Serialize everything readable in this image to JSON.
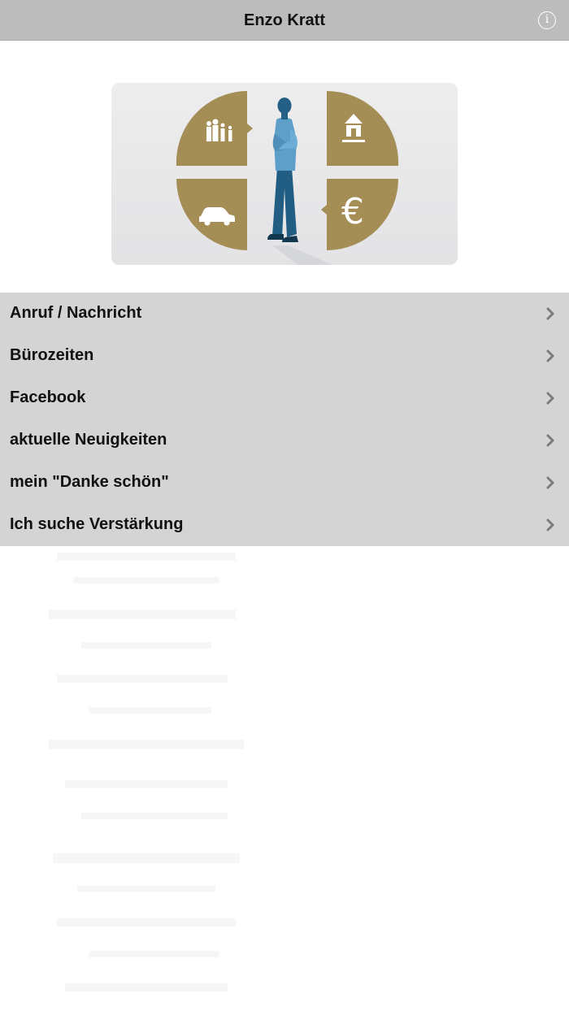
{
  "navbar": {
    "title": "Enzo Kratt",
    "info_icon": "info-icon",
    "info_glyph": "i"
  },
  "hero": {
    "image": "insurance-advisor-illustration",
    "euro_glyph": "€",
    "colors": {
      "gold": "#a48e56",
      "figure": "#2d6a91",
      "background": "#e9e9ea"
    }
  },
  "menu": {
    "chevron_icon": "chevron-right-icon",
    "items": [
      {
        "label": "Anruf / Nachricht"
      },
      {
        "label": "Bürozeiten"
      },
      {
        "label": "Facebook"
      },
      {
        "label": "aktuelle Neuigkeiten"
      },
      {
        "label": "mein \"Danke schön\""
      },
      {
        "label": "Ich suche Verstärkung"
      }
    ]
  }
}
